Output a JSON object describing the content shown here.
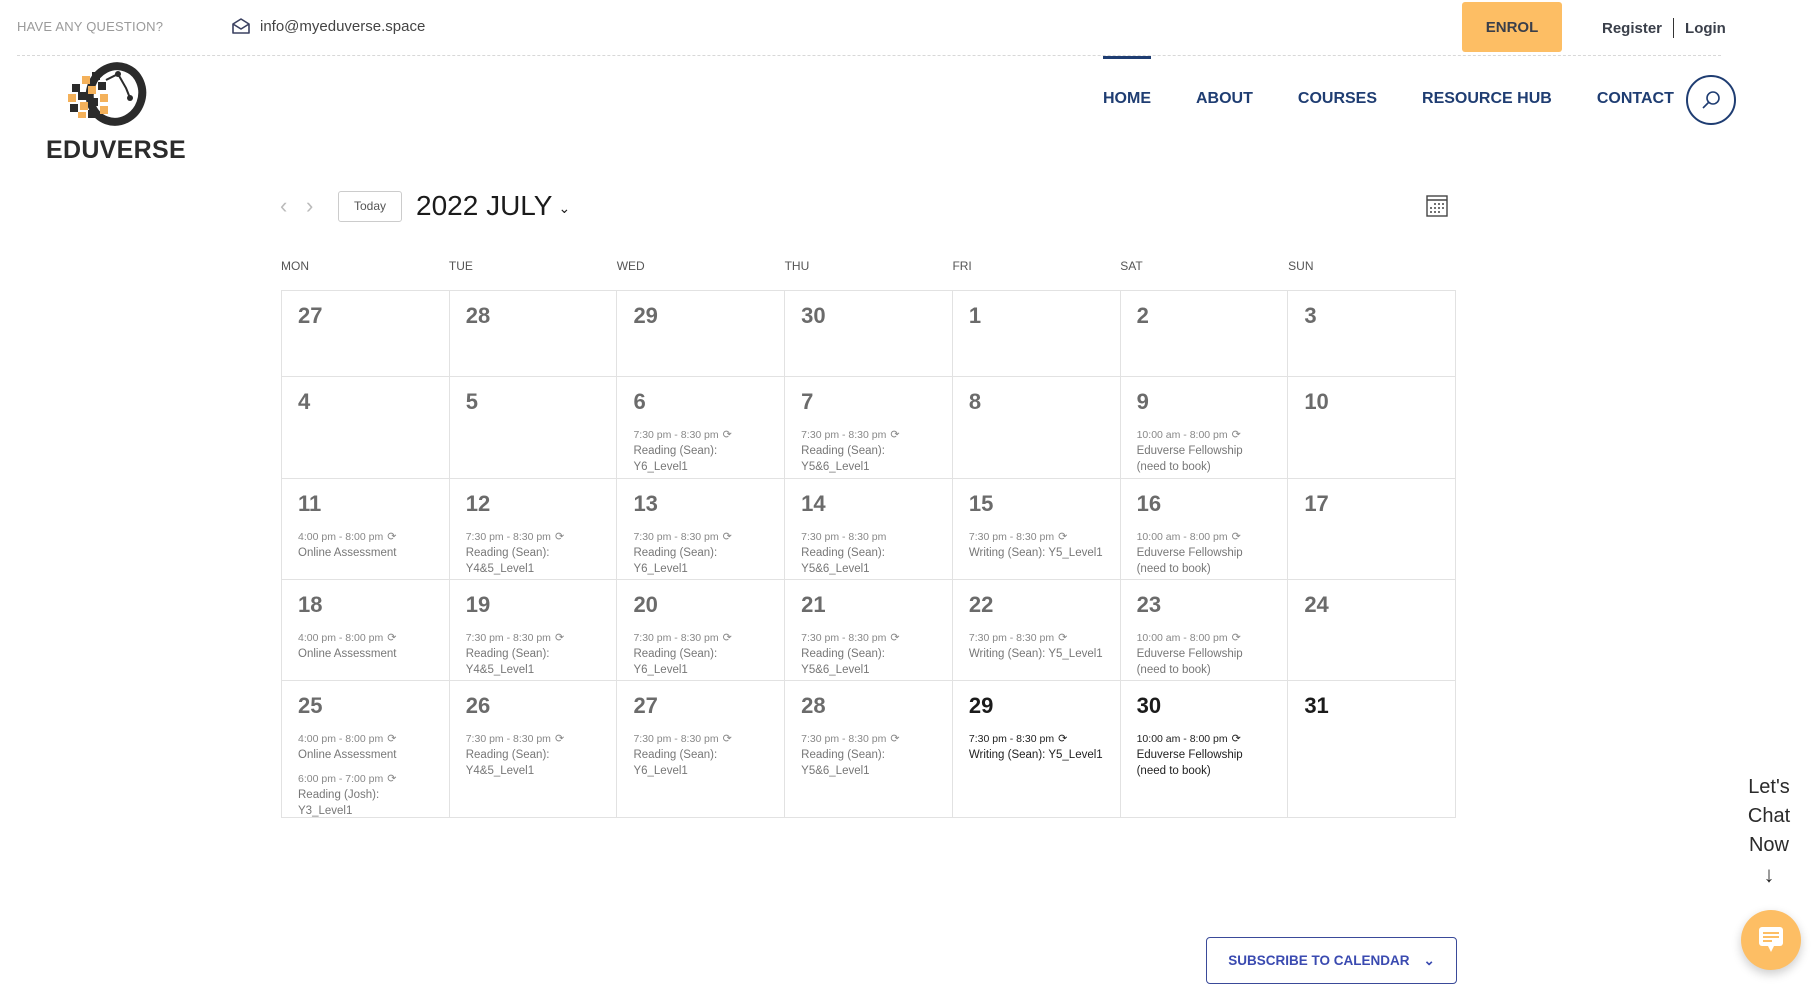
{
  "topbar": {
    "question": "HAVE ANY QUESTION?",
    "email": "info@myeduverse.space",
    "enrol": "ENROL",
    "register": "Register",
    "login": "Login"
  },
  "brand": {
    "name": "EDUVERSE"
  },
  "nav": {
    "items": [
      {
        "label": "HOME",
        "active": true
      },
      {
        "label": "ABOUT"
      },
      {
        "label": "COURSES"
      },
      {
        "label": "RESOURCE HUB"
      },
      {
        "label": "CONTACT"
      }
    ]
  },
  "calendar": {
    "today_label": "Today",
    "month_label": "2022 JULY",
    "weekdays": [
      "MON",
      "TUE",
      "WED",
      "THU",
      "FRI",
      "SAT",
      "SUN"
    ],
    "weeks": [
      [
        {
          "d": "27"
        },
        {
          "d": "28"
        },
        {
          "d": "29"
        },
        {
          "d": "30"
        },
        {
          "d": "1"
        },
        {
          "d": "2"
        },
        {
          "d": "3"
        }
      ],
      [
        {
          "d": "4"
        },
        {
          "d": "5"
        },
        {
          "d": "6",
          "events": [
            {
              "time": "7:30 pm - 8:30 pm",
              "title": "Reading (Sean): Y6_Level1",
              "recurring": true
            }
          ]
        },
        {
          "d": "7",
          "events": [
            {
              "time": "7:30 pm - 8:30 pm",
              "title": "Reading (Sean): Y5&6_Level1",
              "recurring": true
            }
          ]
        },
        {
          "d": "8"
        },
        {
          "d": "9",
          "events": [
            {
              "time": "10:00 am - 8:00 pm",
              "title": "Eduverse Fellowship (need to book)",
              "recurring": true
            }
          ]
        },
        {
          "d": "10"
        }
      ],
      [
        {
          "d": "11",
          "events": [
            {
              "time": "4:00 pm - 8:00 pm",
              "title": "Online Assessment",
              "recurring": true
            }
          ]
        },
        {
          "d": "12",
          "events": [
            {
              "time": "7:30 pm - 8:30 pm",
              "title": "Reading (Sean): Y4&5_Level1",
              "recurring": true
            }
          ]
        },
        {
          "d": "13",
          "events": [
            {
              "time": "7:30 pm - 8:30 pm",
              "title": "Reading (Sean): Y6_Level1",
              "recurring": true
            }
          ]
        },
        {
          "d": "14",
          "events": [
            {
              "time": "7:30 pm - 8:30 pm",
              "title": "Reading (Sean): Y5&6_Level1",
              "recurring": false
            }
          ]
        },
        {
          "d": "15",
          "events": [
            {
              "time": "7:30 pm - 8:30 pm",
              "title": "Writing (Sean): Y5_Level1",
              "recurring": true
            }
          ]
        },
        {
          "d": "16",
          "events": [
            {
              "time": "10:00 am - 8:00 pm",
              "title": "Eduverse Fellowship (need to book)",
              "recurring": true
            }
          ]
        },
        {
          "d": "17"
        }
      ],
      [
        {
          "d": "18",
          "events": [
            {
              "time": "4:00 pm - 8:00 pm",
              "title": "Online Assessment",
              "recurring": true
            }
          ]
        },
        {
          "d": "19",
          "events": [
            {
              "time": "7:30 pm - 8:30 pm",
              "title": "Reading (Sean): Y4&5_Level1",
              "recurring": true
            }
          ]
        },
        {
          "d": "20",
          "events": [
            {
              "time": "7:30 pm - 8:30 pm",
              "title": "Reading (Sean): Y6_Level1",
              "recurring": true
            }
          ]
        },
        {
          "d": "21",
          "events": [
            {
              "time": "7:30 pm - 8:30 pm",
              "title": "Reading (Sean): Y5&6_Level1",
              "recurring": true
            }
          ]
        },
        {
          "d": "22",
          "events": [
            {
              "time": "7:30 pm - 8:30 pm",
              "title": "Writing (Sean): Y5_Level1",
              "recurring": true
            }
          ]
        },
        {
          "d": "23",
          "events": [
            {
              "time": "10:00 am - 8:00 pm",
              "title": "Eduverse Fellowship (need to book)",
              "recurring": true
            }
          ]
        },
        {
          "d": "24"
        }
      ],
      [
        {
          "d": "25",
          "events": [
            {
              "time": "4:00 pm - 8:00 pm",
              "title": "Online Assessment",
              "recurring": true
            },
            {
              "time": "6:00 pm - 7:00 pm",
              "title": "Reading (Josh): Y3_Level1",
              "recurring": true
            }
          ]
        },
        {
          "d": "26",
          "events": [
            {
              "time": "7:30 pm - 8:30 pm",
              "title": "Reading (Sean): Y4&5_Level1",
              "recurring": true
            }
          ]
        },
        {
          "d": "27",
          "events": [
            {
              "time": "7:30 pm - 8:30 pm",
              "title": "Reading (Sean): Y6_Level1",
              "recurring": true
            }
          ]
        },
        {
          "d": "28",
          "events": [
            {
              "time": "7:30 pm - 8:30 pm",
              "title": "Reading (Sean): Y5&6_Level1",
              "recurring": true
            }
          ]
        },
        {
          "d": "29",
          "future": true,
          "events": [
            {
              "time": "7:30 pm - 8:30 pm",
              "title": "Writing (Sean): Y5_Level1",
              "recurring": true
            }
          ]
        },
        {
          "d": "30",
          "future": true,
          "events": [
            {
              "time": "10:00 am - 8:00 pm",
              "title": "Eduverse Fellowship (need to book)",
              "recurring": true
            }
          ]
        },
        {
          "d": "31",
          "future": true
        }
      ]
    ],
    "subscribe_label": "SUBSCRIBE TO CALENDAR"
  },
  "chat": {
    "lines": [
      "Let's",
      "Chat",
      "Now"
    ],
    "arrow": "↓"
  },
  "colors": {
    "accent": "#fdbe64",
    "nav": "#1f3d72",
    "subscribe": "#3a4ab0"
  }
}
